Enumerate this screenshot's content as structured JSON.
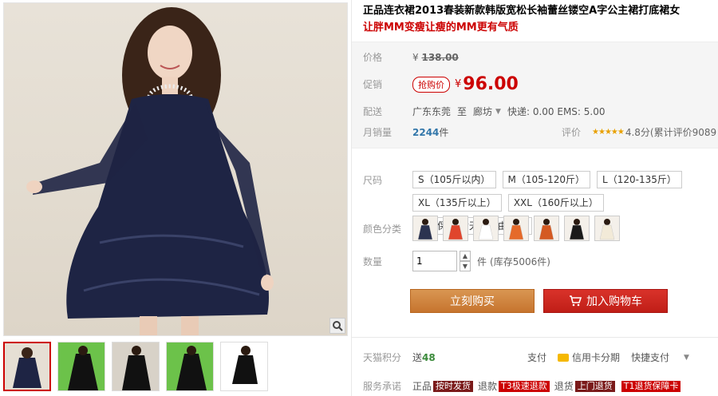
{
  "product": {
    "title": "正品连衣裙2013春装新款韩版宽松长袖蕾丝镂空A字公主裙打底裙女",
    "subtitle": "让胖MM变瘦让瘦的MM更有气质"
  },
  "price": {
    "label": "价格",
    "original": "138.00",
    "currency": "¥"
  },
  "promo": {
    "label": "促销",
    "tag": "抢购价",
    "price": "96.00"
  },
  "shipping": {
    "label": "配送",
    "from": "广东东莞",
    "to_word": "至",
    "dest": "廊坊",
    "fees": "快递: 0.00 EMS: 5.00"
  },
  "sales": {
    "label": "月销量",
    "count": "2244",
    "unit": "件",
    "rating_label": "评价",
    "stars": "★★★★★",
    "score": "4.8分(累计评价9089"
  },
  "size": {
    "label": "尺码",
    "options": [
      "S（105斤以内）",
      "M（105-120斤）",
      "L（120-135斤）",
      "XL（135斤以上）",
      "XXL（160斤以上）",
      "质量保证,七天无理由退换"
    ]
  },
  "color": {
    "label": "颜色分类",
    "swatches": [
      "#2b3350",
      "#e0452c",
      "#ffffff",
      "#e56a2a",
      "#d45a22",
      "#1a1a1a",
      "#f2ead8"
    ]
  },
  "quantity": {
    "label": "数量",
    "value": "1",
    "unit": "件",
    "stock": "(库存5006件)"
  },
  "actions": {
    "buy": "立刻购买",
    "cart": "加入购物车"
  },
  "bottom": {
    "points_label": "天猫积分",
    "points_prefix": "送",
    "points_value": "48",
    "pay_label": "支付",
    "credit": "信用卡分期",
    "quick": "快捷支付",
    "service_label": "服务承诺",
    "svc1_pre": "正品",
    "svc1_tag": "按时发货",
    "svc2_pre": "退款",
    "svc2_tag": "T3极速退款",
    "svc3_pre": "退货",
    "svc3_tag": "上门退货",
    "svc4_tag": "T1退货保障卡"
  }
}
